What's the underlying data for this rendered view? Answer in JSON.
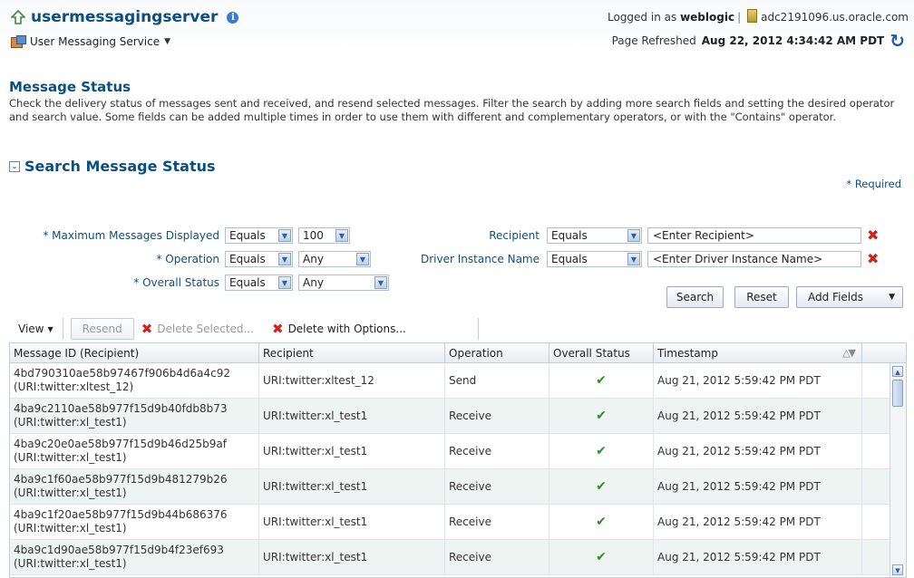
{
  "header": {
    "app_title": "usermessagingserver",
    "logged_in_prefix": "Logged in as",
    "user": "weblogic",
    "host": "adc2191096.us.oracle.com",
    "service_menu": "User Messaging Service",
    "page_refreshed_prefix": "Page Refreshed",
    "page_refreshed_time": "Aug 22, 2012 4:34:42 AM PDT"
  },
  "page": {
    "title": "Message Status",
    "description": "Check the delivery status of messages sent and received, and resend selected messages. Filter the search by adding more search fields and setting the desired operator and search value. Some fields can be added multiple times in order to use them with different and complementary operators, or with the \"Contains\" operator.",
    "section_title": "Search Message Status",
    "required_note": "Required"
  },
  "form": {
    "max_messages_label": "Maximum Messages Displayed",
    "max_messages_operator": "Equals",
    "max_messages_value": "100",
    "operation_label": "Operation",
    "operation_operator": "Equals",
    "operation_value": "Any",
    "overall_status_label": "Overall Status",
    "overall_status_operator": "Equals",
    "overall_status_value": "Any",
    "recipient_label": "Recipient",
    "recipient_operator": "Equals",
    "recipient_placeholder": "<Enter Recipient>",
    "driver_label": "Driver Instance Name",
    "driver_operator": "Equals",
    "driver_placeholder": "<Enter Driver Instance Name>"
  },
  "buttons": {
    "search": "Search",
    "reset": "Reset",
    "add_fields": "Add Fields"
  },
  "toolbar": {
    "view": "View",
    "resend": "Resend",
    "delete_selected": "Delete Selected...",
    "delete_with_options": "Delete with Options..."
  },
  "table": {
    "columns": [
      "Message ID (Recipient)",
      "Recipient",
      "Operation",
      "Overall Status",
      "Timestamp"
    ],
    "rows": [
      {
        "id": "4bd790310ae58b97467f906b4d6a4c92",
        "id_recipient": "(URI:twitter:xltest_12)",
        "recipient": "URI:twitter:xltest_12",
        "operation": "Send",
        "timestamp": "Aug 21, 2012 5:59:42 PM PDT"
      },
      {
        "id": "4ba9c2110ae58b977f15d9b40fdb8b73",
        "id_recipient": "(URI:twitter:xl_test1)",
        "recipient": "URI:twitter:xl_test1",
        "operation": "Receive",
        "timestamp": "Aug 21, 2012 5:59:42 PM PDT"
      },
      {
        "id": "4ba9c20e0ae58b977f15d9b46d25b9af",
        "id_recipient": "(URI:twitter:xl_test1)",
        "recipient": "URI:twitter:xl_test1",
        "operation": "Receive",
        "timestamp": "Aug 21, 2012 5:59:42 PM PDT"
      },
      {
        "id": "4ba9c1f60ae58b977f15d9b481279b26",
        "id_recipient": "(URI:twitter:xl_test1)",
        "recipient": "URI:twitter:xl_test1",
        "operation": "Receive",
        "timestamp": "Aug 21, 2012 5:59:42 PM PDT"
      },
      {
        "id": "4ba9c1f20ae58b977f15d9b44b686376",
        "id_recipient": "(URI:twitter:xl_test1)",
        "recipient": "URI:twitter:xl_test1",
        "operation": "Receive",
        "timestamp": "Aug 21, 2012 5:59:42 PM PDT"
      },
      {
        "id": "4ba9c1d90ae58b977f15d9b4f23ef693",
        "id_recipient": "(URI:twitter:xl_test1)",
        "recipient": "URI:twitter:xl_test1",
        "operation": "Receive",
        "timestamp": "Aug 21, 2012 5:59:42 PM PDT"
      }
    ]
  },
  "colors": {
    "brand_blue": "#0b4f82",
    "delete_red": "#d0241d",
    "check_green": "#2e8b2e"
  }
}
